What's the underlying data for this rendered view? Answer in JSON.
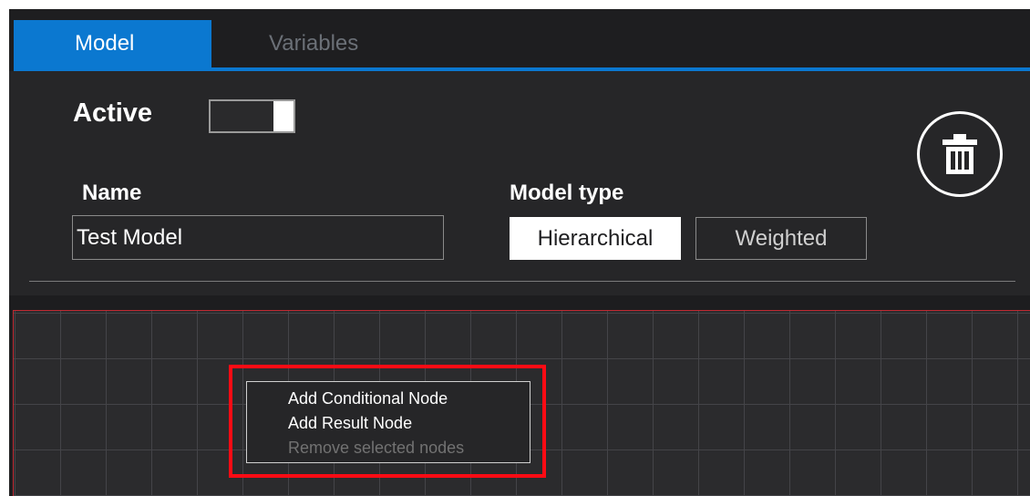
{
  "tabs": [
    {
      "label": "Model",
      "selected": true
    },
    {
      "label": "Variables",
      "selected": false
    }
  ],
  "header": {
    "active_label": "Active",
    "active_toggle_on": true,
    "delete_icon": "trash-icon"
  },
  "form": {
    "name_label": "Name",
    "name_value": "Test Model",
    "model_type_label": "Model type",
    "model_type_options": [
      {
        "label": "Hierarchical",
        "selected": true
      },
      {
        "label": "Weighted",
        "selected": false
      }
    ]
  },
  "context_menu": {
    "items": [
      {
        "label": "Add Conditional Node",
        "enabled": true
      },
      {
        "label": "Add Result Node",
        "enabled": true
      },
      {
        "label": "Remove selected nodes",
        "enabled": false
      }
    ]
  },
  "colors": {
    "accent": "#0b78d0",
    "background": "#1e1e20",
    "panel": "#262628",
    "highlight": "#ff0b14"
  }
}
